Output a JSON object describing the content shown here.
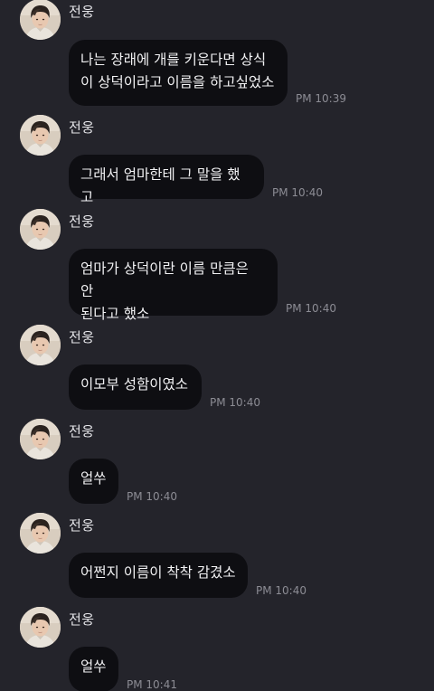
{
  "messages": [
    {
      "sender": "전웅",
      "text": "나는 장래에 개를 키운다면 상식\n이 상덕이라고 이름을 하고싶었소",
      "time": "PM 10:39"
    },
    {
      "sender": "전웅",
      "text": "그래서 엄마한테 그 말을 했고",
      "time": "PM 10:40"
    },
    {
      "sender": "전웅",
      "text": "엄마가 상덕이란 이름 만큼은 안\n된다고 했소",
      "time": "PM 10:40"
    },
    {
      "sender": "전웅",
      "text": "이모부 성함이였소",
      "time": "PM 10:40"
    },
    {
      "sender": "전웅",
      "text": "얼쑤",
      "time": "PM 10:40"
    },
    {
      "sender": "전웅",
      "text": "어쩐지 이름이 착착 감겼소",
      "time": "PM 10:40"
    },
    {
      "sender": "전웅",
      "text": "얼쑤",
      "time": "PM 10:41"
    }
  ]
}
